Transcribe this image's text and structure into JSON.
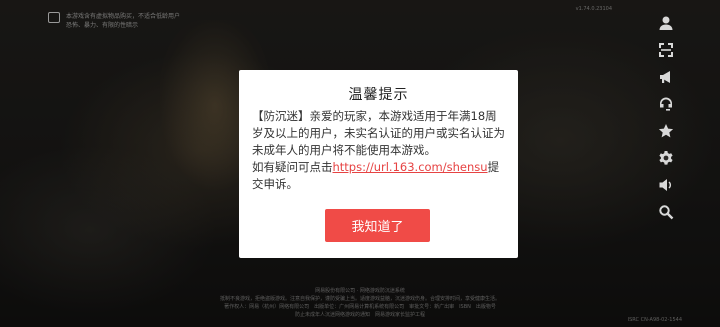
{
  "background": {
    "notice_line1": "本游戏含有虚拟物品购买，不适合低龄用户",
    "notice_line2": "恐怖、暴力、有限的性暗示",
    "version_top": "v1.74.0.23104",
    "footer_line1": "网易股份有限公司 · 网络游戏防沉迷系统",
    "footer_line2": "抵制不良游戏，拒绝盗版游戏。注意自我保护，谨防受骗上当。适度游戏益脑，沉迷游戏伤身。合理安排时间，享受健康生活。",
    "footer_line3": "著作权人：网易（杭州）网络有限公司　出版单位：广州网易计算机系统有限公司　审批文号：新广出审　ISBN　出版物号",
    "footer_line4": "防止未成年人沉迷网络游戏的通知　网易游戏家长监护工程",
    "version_bottom": "ISRC CN-A98-02-1544"
  },
  "sidebar": {
    "icons": [
      "user-icon",
      "scan-icon",
      "megaphone-icon",
      "headset-icon",
      "star-icon",
      "settings-gear-icon",
      "speaker-icon",
      "search-icon"
    ]
  },
  "dialog": {
    "title": "温馨提示",
    "body_text": "【防沉迷】亲爱的玩家，本游戏适用于年满18周岁及以上的用户，未实名认证的用户或实名认证为未成年人的用户将不能使用本游戏。",
    "help_prefix": "如有疑问可点击",
    "help_link": "https://url.163.com/shensu",
    "help_suffix": "提交申诉。",
    "ok_button": "我知道了"
  },
  "colors": {
    "accent": "#f04b47",
    "link": "#e64343"
  }
}
